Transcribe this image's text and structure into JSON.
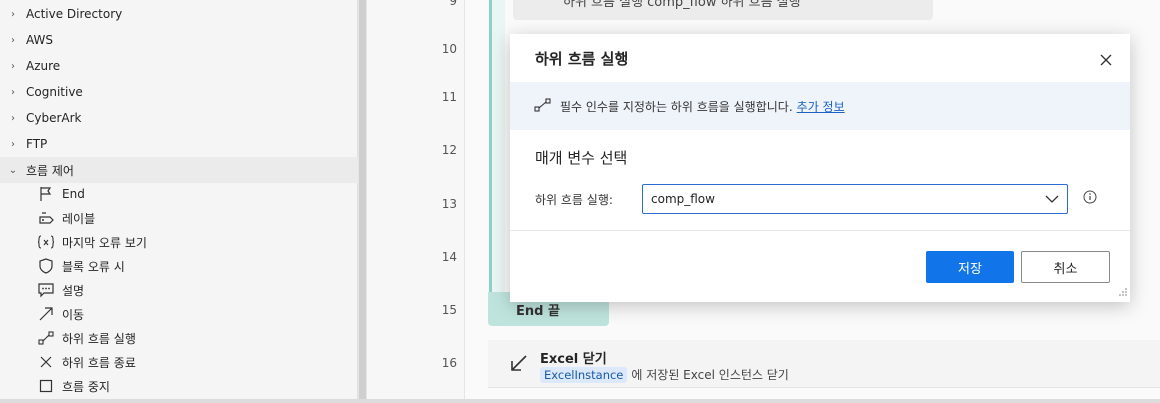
{
  "sidebar": {
    "categories": [
      {
        "label": "Active Directory"
      },
      {
        "label": "AWS"
      },
      {
        "label": "Azure"
      },
      {
        "label": "Cognitive"
      },
      {
        "label": "CyberArk"
      },
      {
        "label": "FTP"
      },
      {
        "label": "흐름 제어"
      }
    ],
    "items": [
      {
        "label": "End",
        "icon": "flag-icon"
      },
      {
        "label": "레이블",
        "icon": "label-icon"
      },
      {
        "label": "마지막 오류 보기",
        "icon": "variable-icon"
      },
      {
        "label": "블록 오류 시",
        "icon": "shield-icon"
      },
      {
        "label": "설명",
        "icon": "comment-icon"
      },
      {
        "label": "이동",
        "icon": "arrow-icon"
      },
      {
        "label": "하위 흐름 실행",
        "icon": "subflow-icon"
      },
      {
        "label": "하위 흐름 종료",
        "icon": "close-x-icon"
      },
      {
        "label": "흐름 중지",
        "icon": "stop-square-icon"
      }
    ]
  },
  "canvas": {
    "line_numbers": [
      "9",
      "10",
      "11",
      "12",
      "13",
      "14",
      "15",
      "16"
    ],
    "step9_text": "하위 흐름 실행 comp_flow 하위 흐름 실행",
    "end_label": "End 끝",
    "excel": {
      "title": "Excel 닫기",
      "token": "ExcelInstance",
      "desc": "에 저장된 Excel 인스턴스 닫기"
    }
  },
  "dialog": {
    "title": "하위 흐름 실행",
    "info_text": "필수 인수를 지정하는 하위 흐름을 실행합니다.",
    "info_link": "추가 정보",
    "section_title": "매개 변수 선택",
    "field_label": "하위 흐름 실행:",
    "field_value": "comp_flow",
    "save_label": "저장",
    "cancel_label": "취소",
    "accent_color": "#1174e8"
  }
}
